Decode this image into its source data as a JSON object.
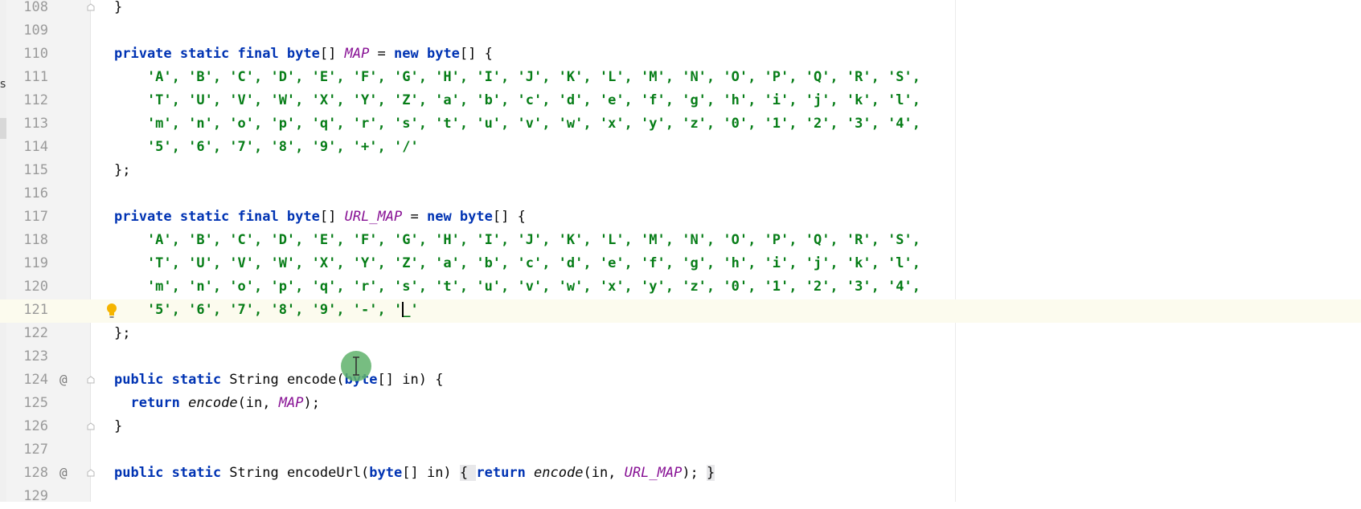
{
  "sidebar": {
    "partial_label": "ss"
  },
  "editor": {
    "lines": [
      {
        "num": "108",
        "tokens": [
          {
            "t": "}",
            "c": ""
          }
        ],
        "fold": true
      },
      {
        "num": "109",
        "tokens": []
      },
      {
        "num": "110",
        "tokens": [
          {
            "t": "private static final byte",
            "c": "kw"
          },
          {
            "t": "[] ",
            "c": ""
          },
          {
            "t": "MAP",
            "c": "fld"
          },
          {
            "t": " = ",
            "c": ""
          },
          {
            "t": "new byte",
            "c": "kw"
          },
          {
            "t": "[] {",
            "c": ""
          }
        ]
      },
      {
        "num": "111",
        "tokens": [
          {
            "t": "    'A', 'B', 'C', 'D', 'E', 'F', 'G', 'H', 'I', 'J', 'K', 'L', 'M', 'N', 'O', 'P', 'Q', 'R', 'S',",
            "c": "str"
          }
        ]
      },
      {
        "num": "112",
        "tokens": [
          {
            "t": "    'T', 'U', 'V', 'W', 'X', 'Y', 'Z', 'a', 'b', 'c', 'd', 'e', 'f', 'g', 'h', 'i', 'j', 'k', 'l',",
            "c": "str"
          }
        ]
      },
      {
        "num": "113",
        "tokens": [
          {
            "t": "    'm', 'n', 'o', 'p', 'q', 'r', 's', 't', 'u', 'v', 'w', 'x', 'y', 'z', '0', '1', '2', '3', '4',",
            "c": "str"
          }
        ]
      },
      {
        "num": "114",
        "tokens": [
          {
            "t": "    '5', '6', '7', '8', '9', '+', '/'",
            "c": "str"
          }
        ]
      },
      {
        "num": "115",
        "tokens": [
          {
            "t": "};",
            "c": ""
          }
        ]
      },
      {
        "num": "116",
        "tokens": []
      },
      {
        "num": "117",
        "tokens": [
          {
            "t": "private static final byte",
            "c": "kw"
          },
          {
            "t": "[] ",
            "c": ""
          },
          {
            "t": "URL_MAP",
            "c": "fld"
          },
          {
            "t": " = ",
            "c": ""
          },
          {
            "t": "new byte",
            "c": "kw"
          },
          {
            "t": "[] {",
            "c": ""
          }
        ]
      },
      {
        "num": "118",
        "tokens": [
          {
            "t": "    'A', 'B', 'C', 'D', 'E', 'F', 'G', 'H', 'I', 'J', 'K', 'L', 'M', 'N', 'O', 'P', 'Q', 'R', 'S',",
            "c": "str"
          }
        ]
      },
      {
        "num": "119",
        "tokens": [
          {
            "t": "    'T', 'U', 'V', 'W', 'X', 'Y', 'Z', 'a', 'b', 'c', 'd', 'e', 'f', 'g', 'h', 'i', 'j', 'k', 'l',",
            "c": "str"
          }
        ]
      },
      {
        "num": "120",
        "tokens": [
          {
            "t": "    'm', 'n', 'o', 'p', 'q', 'r', 's', 't', 'u', 'v', 'w', 'x', 'y', 'z', '0', '1', '2', '3', '4',",
            "c": "str"
          }
        ]
      },
      {
        "num": "121",
        "tokens": [
          {
            "t": "    '5', '6', '7', '8', '9', '-', '",
            "c": "str"
          },
          {
            "t": "",
            "c": "caret"
          },
          {
            "t": "_'",
            "c": "str"
          }
        ],
        "current": true,
        "bulb": true
      },
      {
        "num": "122",
        "tokens": [
          {
            "t": "};",
            "c": ""
          }
        ]
      },
      {
        "num": "123",
        "tokens": []
      },
      {
        "num": "124",
        "tokens": [
          {
            "t": "public static ",
            "c": "kw"
          },
          {
            "t": "String encode(",
            "c": ""
          },
          {
            "t": "byte",
            "c": "kw"
          },
          {
            "t": "[] in) {",
            "c": ""
          }
        ],
        "annotation": "@",
        "fold": true
      },
      {
        "num": "125",
        "tokens": [
          {
            "t": "  ",
            "c": ""
          },
          {
            "t": "return ",
            "c": "kw"
          },
          {
            "t": "encode",
            "c": "it"
          },
          {
            "t": "(in, ",
            "c": ""
          },
          {
            "t": "MAP",
            "c": "fld"
          },
          {
            "t": ");",
            "c": ""
          }
        ]
      },
      {
        "num": "126",
        "tokens": [
          {
            "t": "}",
            "c": ""
          }
        ],
        "fold": true
      },
      {
        "num": "127",
        "tokens": []
      },
      {
        "num": "128",
        "tokens": [
          {
            "t": "public static ",
            "c": "kw"
          },
          {
            "t": "String encodeUrl(",
            "c": ""
          },
          {
            "t": "byte",
            "c": "kw"
          },
          {
            "t": "[] in) ",
            "c": ""
          },
          {
            "t": "{ ",
            "c": "brace-hl"
          },
          {
            "t": "return ",
            "c": "kw"
          },
          {
            "t": "encode",
            "c": "it"
          },
          {
            "t": "(in, ",
            "c": ""
          },
          {
            "t": "URL_MAP",
            "c": "fld"
          },
          {
            "t": "); ",
            "c": ""
          },
          {
            "t": "}",
            "c": "brace-hl"
          }
        ],
        "annotation": "@",
        "fold": true
      },
      {
        "num": "129",
        "tokens": []
      }
    ]
  },
  "colors": {
    "keyword": "#0033b3",
    "field": "#871094",
    "string": "#067d17",
    "line_number": "#9a9a9a",
    "current_line": "#fcfbee",
    "cursor_highlight": "#5fb26b"
  },
  "icons": {
    "bulb": "lightbulb-icon",
    "fold": "fold-icon",
    "cursor": "i-beam-cursor-icon"
  }
}
